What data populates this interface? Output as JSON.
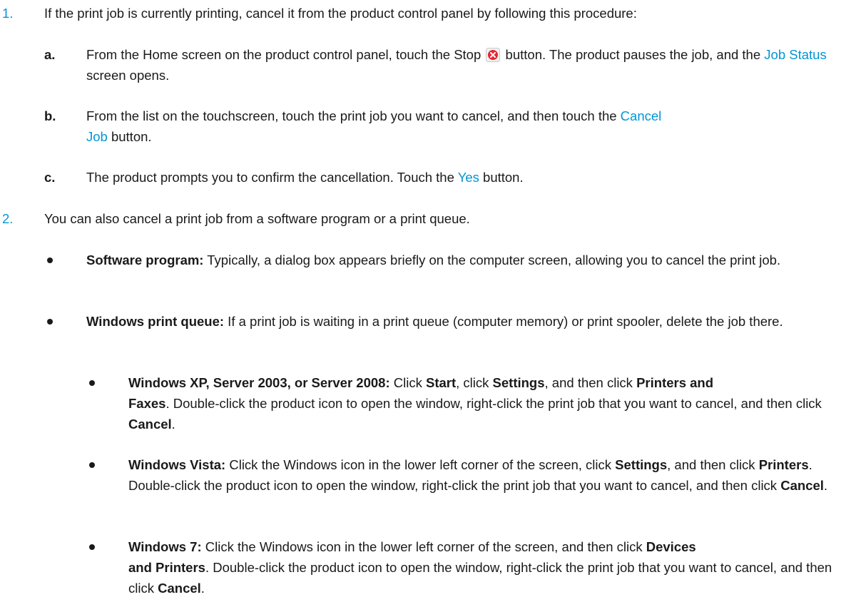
{
  "steps": [
    {
      "number": "1.",
      "text": "If the print job is currently printing, cancel it from the product control panel by following this procedure:",
      "substeps": [
        {
          "letter": "a.",
          "pre_text": "From the Home screen on the product control panel, touch the Stop ",
          "icon": "stop-icon",
          "mid_text": " button. The product pauses the job, and the ",
          "ui_label": "Job Status",
          "post_text": " screen opens."
        },
        {
          "letter": "b.",
          "pre_text": "From the list on the touchscreen, touch the print job you want to cancel, and then touch the ",
          "ui_label_line1": "Cancel",
          "ui_label_line2": "Job",
          "post_text": " button."
        },
        {
          "letter": "c.",
          "pre_text": "The product prompts you to confirm the cancellation. Touch the ",
          "ui_label": "Yes",
          "post_text": " button."
        }
      ]
    },
    {
      "number": "2.",
      "text": "You can also cancel a print job from a software program or a print queue.",
      "bullets": [
        {
          "bold": "Software program:",
          "text": " Typically, a dialog box appears briefly on the computer screen, allowing you to cancel the print job."
        },
        {
          "bold": "Windows print queue:",
          "text": " If a print job is waiting in a print queue (computer memory) or print spooler, delete the job there.",
          "sub_bullets": [
            {
              "bold": "Windows XP, Server 2003, or Server 2008:",
              "t1": " Click ",
              "b1": "Start",
              "t2": ", click ",
              "b2": "Settings",
              "t3": ", and then click ",
              "b3a": "Printers and",
              "b3b": "Faxes",
              "t4": ". Double-click the product icon to open the window, right-click the print job that you want to cancel, and then click ",
              "b4": "Cancel",
              "t5": "."
            },
            {
              "bold": "Windows Vista:",
              "t1": " Click the Windows icon in the lower left corner of the screen, click ",
              "b1": "Settings",
              "t2": ", and then click ",
              "b2": "Printers",
              "t3": ". Double-click the product icon to open the window, right-click the print job that you want to cancel, and then click ",
              "b3": "Cancel",
              "t4": "."
            },
            {
              "bold": "Windows 7:",
              "t1": " Click the Windows icon in the lower left corner of the screen, and then click ",
              "b1a": "Devices",
              "b1b": "and Printers",
              "t2": ". Double-click the product icon to open the window, right-click the print job that you want to cancel, and then click ",
              "b2": "Cancel",
              "t3": "."
            }
          ]
        }
      ]
    }
  ],
  "colors": {
    "accent": "#0096d6",
    "text": "#1a1a1a",
    "stop_icon": "#e8252f"
  }
}
